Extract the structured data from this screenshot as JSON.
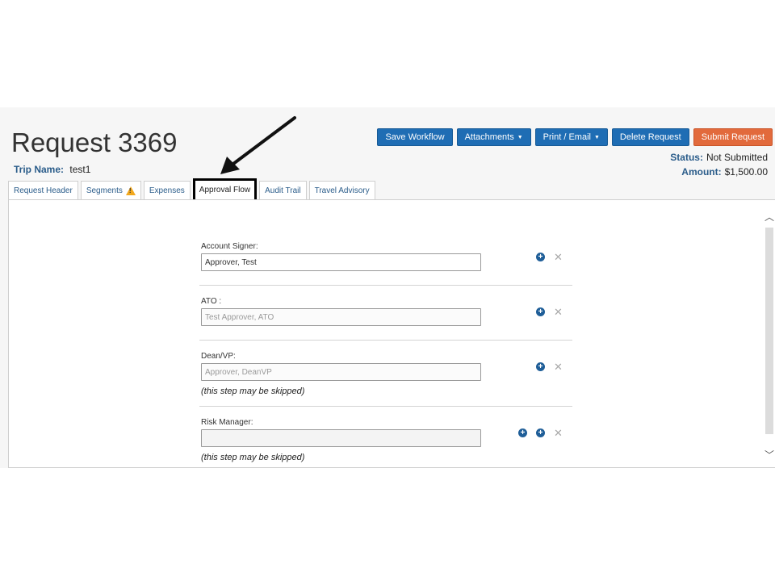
{
  "page": {
    "title": "Request 3369"
  },
  "trip": {
    "label": "Trip Name:",
    "value": "test1"
  },
  "toolbar": {
    "save_workflow": "Save Workflow",
    "attachments": "Attachments",
    "print_email": "Print / Email",
    "delete_request": "Delete Request",
    "submit_request": "Submit Request"
  },
  "status": {
    "label": "Status:",
    "value": "Not Submitted",
    "amount_label": "Amount:",
    "amount_value": "$1,500.00"
  },
  "tabs": [
    {
      "label": "Request Header"
    },
    {
      "label": "Segments"
    },
    {
      "label": "Expenses"
    },
    {
      "label": "Approval Flow"
    },
    {
      "label": "Audit Trail"
    },
    {
      "label": "Travel Advisory"
    }
  ],
  "approval_flow": {
    "steps": [
      {
        "label": "Account Signer:",
        "value": "Approver, Test"
      },
      {
        "label": "ATO :",
        "value": "Test Approver, ATO"
      },
      {
        "label": "Dean/VP:",
        "value": "Approver, DeanVP",
        "note": "(this step may be skipped)"
      },
      {
        "label": "Risk Manager:",
        "value": "",
        "note": "(this step may be skipped)"
      }
    ]
  },
  "icons": {
    "add": "plus-circle-icon",
    "remove": "x-icon",
    "warning": "warning-icon"
  },
  "colors": {
    "primary": "#1f6db4",
    "submit": "#e26a3c",
    "active_outline": "#000000"
  }
}
